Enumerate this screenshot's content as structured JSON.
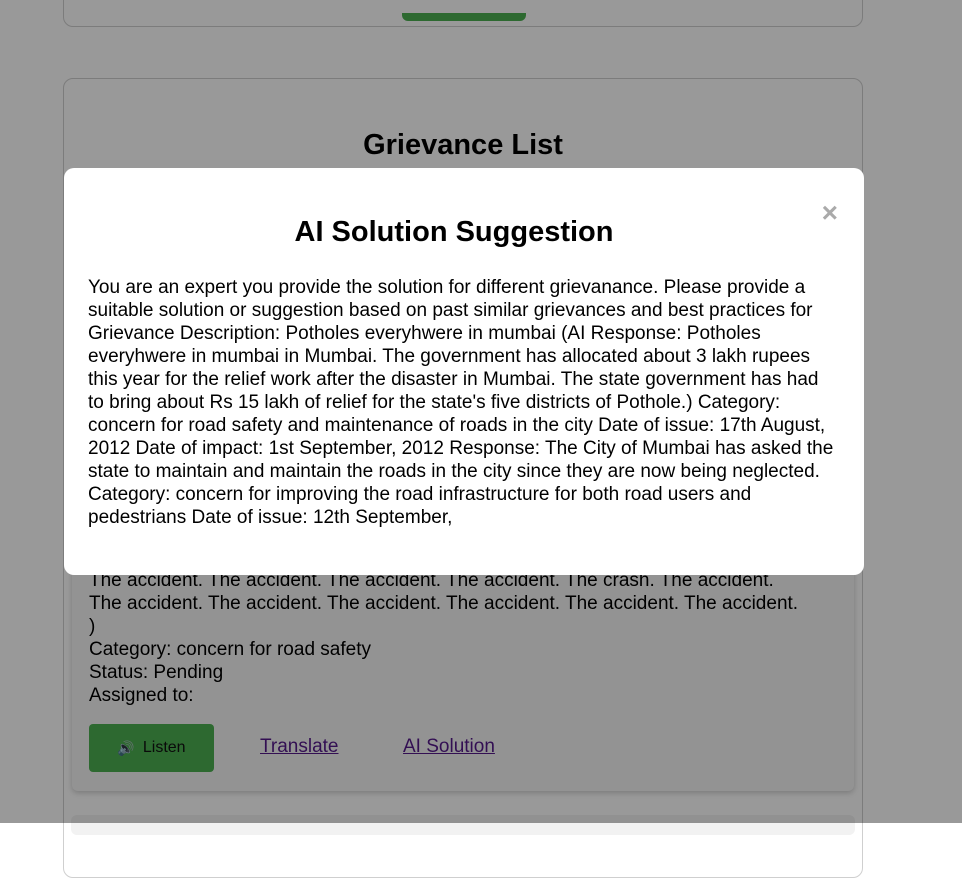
{
  "grievance_list": {
    "title": "Grievance List",
    "card": {
      "description_lines": [
        "The accident. The accident. The accident. The accident. The crash. The accident.",
        "The accident. The accident. The accident. The accident. The accident. The accident.",
        ")"
      ],
      "category": "Category: concern for road safety",
      "status": "Status: Pending",
      "assigned_to": "Assigned to:",
      "listen_label": "Listen",
      "translate_label": "Translate",
      "ai_solution_label": "AI Solution"
    }
  },
  "modal": {
    "title": "AI Solution Suggestion",
    "close_symbol": "×",
    "body": "You are an expert you provide the solution for different grievanance. Please provide a suitable solution or suggestion based on past similar grievances and best practices for Grievance Description: Potholes everyhwere in mumbai (AI Response: Potholes everyhwere in mumbai in Mumbai. The government has allocated about 3 lakh rupees this year for the relief work after the disaster in Mumbai. The state government has had to bring about Rs 15 lakh of relief for the state's five districts of Pothole.) Category: concern for road safety and maintenance of roads in the city Date of issue: 17th August, 2012 Date of impact: 1st September, 2012 Response: The City of Mumbai has asked the state to maintain and maintain the roads in the city since they are now being neglected. Category: concern for improving the road infrastructure for both road users and pedestrians Date of issue: 12th September,"
  },
  "colors": {
    "accent_green": "#4caf50",
    "link_visited": "#551a8b",
    "overlay": "rgba(0,0,0,0.4)"
  },
  "icons": {
    "listen": "speaker-icon",
    "close": "close-icon"
  }
}
